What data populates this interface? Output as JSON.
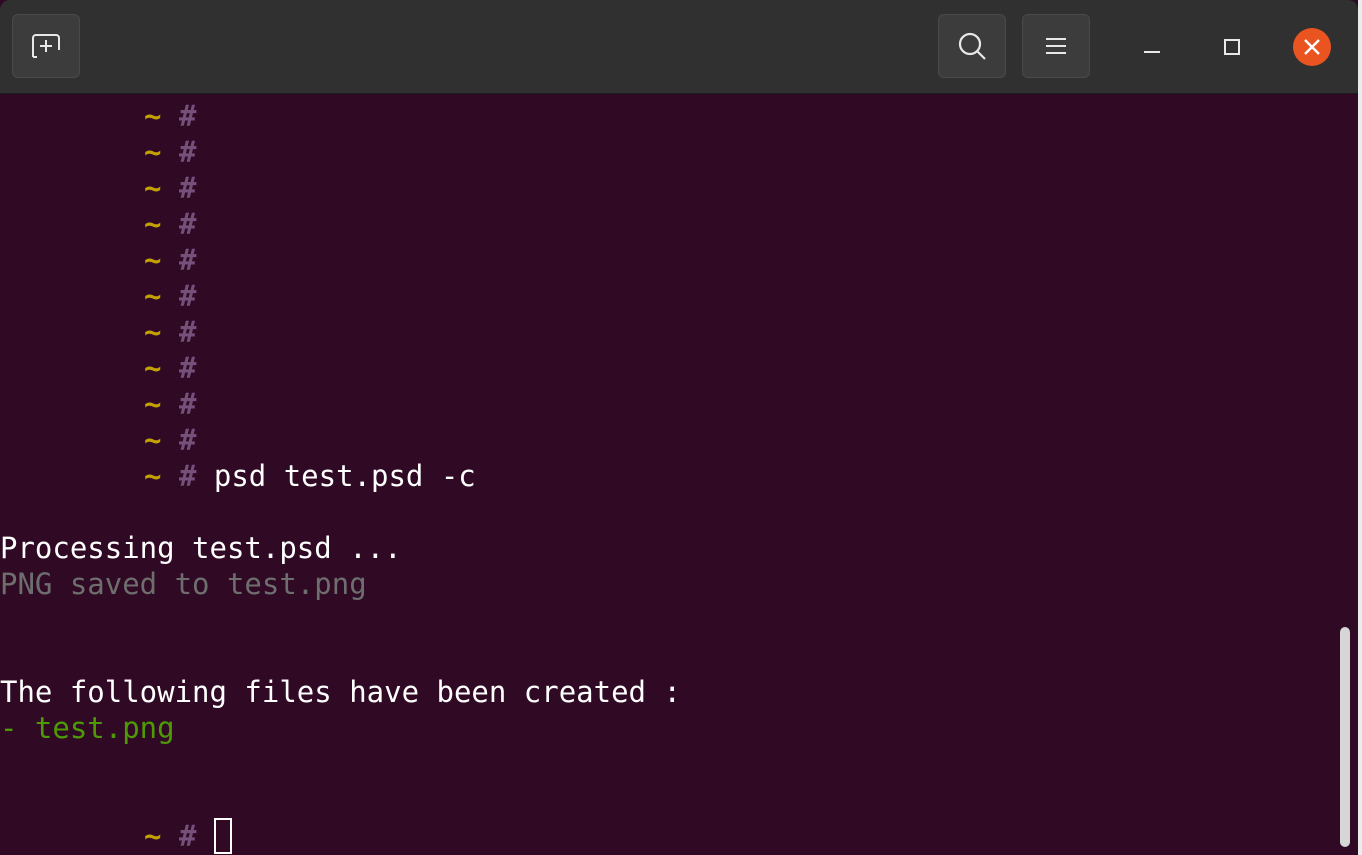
{
  "header": {
    "new_tab_icon": "new-tab-icon",
    "search_icon": "search-icon",
    "menu_icon": "hamburger-menu-icon",
    "minimize_icon": "minimize-icon",
    "maximize_icon": "maximize-icon",
    "close_icon": "close-icon"
  },
  "colors": {
    "terminal_bg": "#300a24",
    "prompt_tilde": "#c4a000",
    "prompt_hash": "#75507b",
    "dim_text": "#6e6e6e",
    "green_text": "#4e9a06",
    "close_button": "#e95420"
  },
  "terminal": {
    "prompt_tilde": "~",
    "prompt_hash": "#",
    "empty_prompt_count": 10,
    "command": "psd test.psd -c",
    "processing": "Processing test.psd ...",
    "saved": "PNG saved to test.png",
    "created_heading": "The following files have been created :",
    "created_file_dash": "- ",
    "created_file": "test.png"
  }
}
